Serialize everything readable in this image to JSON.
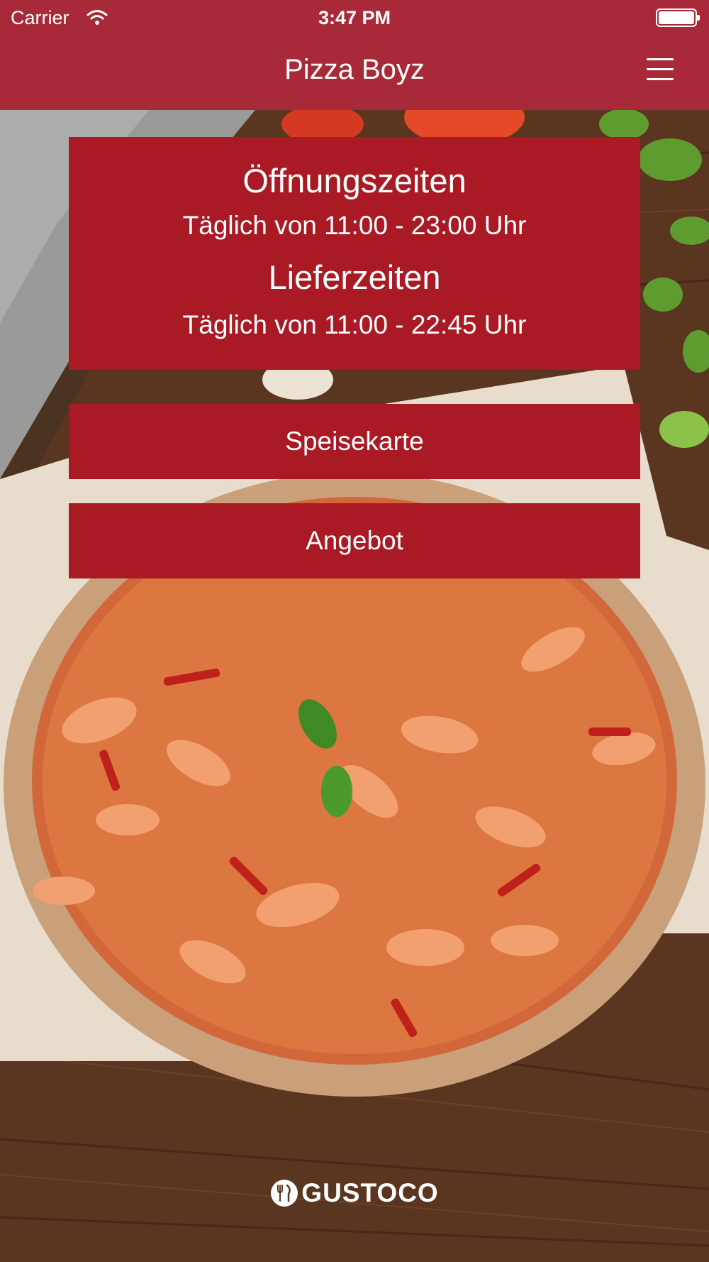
{
  "status_bar": {
    "carrier": "Carrier",
    "time": "3:47 PM"
  },
  "nav": {
    "title": "Pizza Boyz",
    "menu_icon": "hamburger-menu-icon"
  },
  "info": {
    "opening_heading": "Öffnungszeiten",
    "opening_hours": "Täglich von 11:00 - 23:00 Uhr",
    "delivery_heading": "Lieferzeiten",
    "delivery_hours": "Täglich von 11:00 - 22:45 Uhr"
  },
  "buttons": {
    "menu_label": "Speisekarte",
    "offer_label": "Angebot"
  },
  "footer": {
    "brand": "GUSTOCO",
    "brand_icon": "gustoco-logo-icon"
  },
  "colors": {
    "nav": "#a82a38",
    "card": "#a91a24",
    "text": "#ffffff"
  }
}
